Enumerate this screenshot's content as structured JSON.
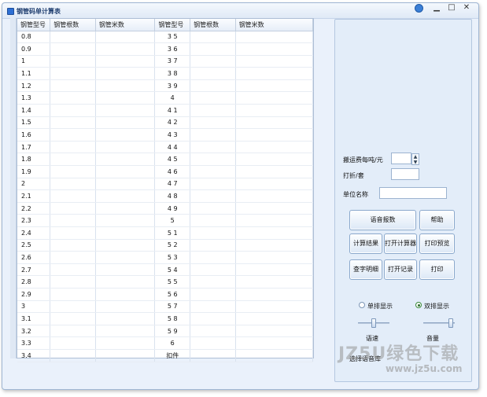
{
  "window": {
    "title": "钢管码单计算表",
    "minimize_glyph": "▁",
    "maximize_glyph": "□",
    "close_glyph": "✕"
  },
  "table": {
    "headers": [
      "钢管型号",
      "钢管根数",
      "钢管米数",
      "钢管型号",
      "钢管根数",
      "钢管米数"
    ],
    "rows": [
      [
        "0.8",
        "",
        "",
        "3 5",
        "",
        ""
      ],
      [
        "0.9",
        "",
        "",
        "3 6",
        "",
        ""
      ],
      [
        "1",
        "",
        "",
        "3 7",
        "",
        ""
      ],
      [
        "1.1",
        "",
        "",
        "3 8",
        "",
        ""
      ],
      [
        "1.2",
        "",
        "",
        "3 9",
        "",
        ""
      ],
      [
        "1.3",
        "",
        "",
        "4",
        "",
        ""
      ],
      [
        "1.4",
        "",
        "",
        "4 1",
        "",
        ""
      ],
      [
        "1.5",
        "",
        "",
        "4 2",
        "",
        ""
      ],
      [
        "1.6",
        "",
        "",
        "4 3",
        "",
        ""
      ],
      [
        "1.7",
        "",
        "",
        "4 4",
        "",
        ""
      ],
      [
        "1.8",
        "",
        "",
        "4 5",
        "",
        ""
      ],
      [
        "1.9",
        "",
        "",
        "4 6",
        "",
        ""
      ],
      [
        "2",
        "",
        "",
        "4 7",
        "",
        ""
      ],
      [
        "2.1",
        "",
        "",
        "4 8",
        "",
        ""
      ],
      [
        "2.2",
        "",
        "",
        "4 9",
        "",
        ""
      ],
      [
        "2.3",
        "",
        "",
        "5",
        "",
        ""
      ],
      [
        "2.4",
        "",
        "",
        "5 1",
        "",
        ""
      ],
      [
        "2.5",
        "",
        "",
        "5 2",
        "",
        ""
      ],
      [
        "2.6",
        "",
        "",
        "5 3",
        "",
        ""
      ],
      [
        "2.7",
        "",
        "",
        "5 4",
        "",
        ""
      ],
      [
        "2.8",
        "",
        "",
        "5 5",
        "",
        ""
      ],
      [
        "2.9",
        "",
        "",
        "5 6",
        "",
        ""
      ],
      [
        "3",
        "",
        "",
        "5 7",
        "",
        ""
      ],
      [
        "3.1",
        "",
        "",
        "5 8",
        "",
        ""
      ],
      [
        "3.2",
        "",
        "",
        "5 9",
        "",
        ""
      ],
      [
        "3.3",
        "",
        "",
        "6",
        "",
        ""
      ],
      [
        "3.4",
        "",
        "",
        "扣件",
        "",
        ""
      ]
    ]
  },
  "form": {
    "fee_label": "搬运费每吨/元",
    "fee_value": "",
    "spin_up": "▲",
    "spin_down": "▼",
    "discount_label": "打折/套",
    "discount_value": "",
    "company_label": "单位名称",
    "company_value": ""
  },
  "buttons": {
    "voice_report": "语音报数",
    "help": "帮助",
    "calc_result": "计算结果",
    "open_calculator": "打开计算器",
    "print_preview": "打印预览",
    "view_detail": "查字明细",
    "open_record": "打开记录",
    "print": "打印"
  },
  "display": {
    "single_label": "单排显示",
    "double_label": "双排显示",
    "selected": "double"
  },
  "sliders": {
    "speed_label": "语速",
    "volume_label": "音量",
    "speed_level": 0.5,
    "volume_level": 0.95
  },
  "voice_library_label": "选择语音库",
  "watermark": {
    "line1": "JZ5U绿色下载",
    "line2": "www.jz5u.com"
  }
}
